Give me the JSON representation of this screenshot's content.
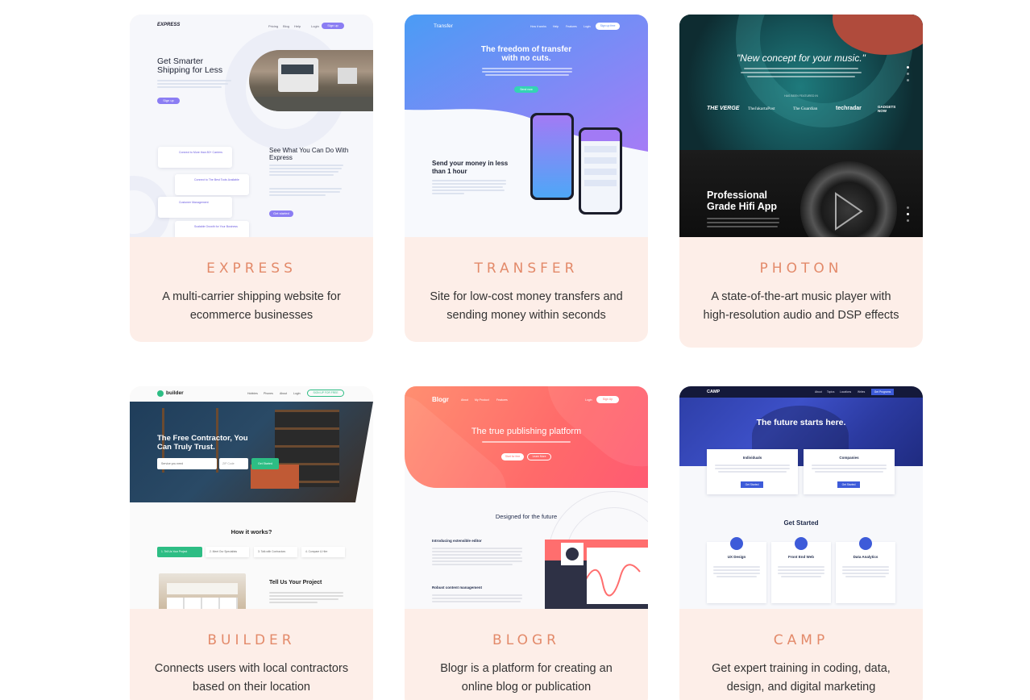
{
  "cards": [
    {
      "title": "EXPRESS",
      "description": "A multi-carrier shipping website for ecommerce businesses",
      "preview": {
        "logo": "EXPRESS",
        "nav": [
          "Pricing",
          "Blog",
          "Help",
          "Login",
          "Sign up"
        ],
        "hero_heading": "Get Smarter Shipping for Less",
        "hero_button": "Sign up",
        "section_heading": "See What You Can Do With Express",
        "section_button": "Get started",
        "features": [
          "Connect to More than 80+ Carriers",
          "Connect to The Best Tools Available",
          "Customer Management",
          "Scalable Growth for Your Business"
        ]
      }
    },
    {
      "title": "TRANSFER",
      "description": "Site for low-cost money transfers and sending money within seconds",
      "preview": {
        "logo": "Transfer",
        "nav": [
          "How it works",
          "Help",
          "Features",
          "Login",
          "Sign up free"
        ],
        "hero_heading": "The freedom of transfer with no cuts.",
        "hero_button": "Send now",
        "section_heading": "Send your money in less than 1 hour"
      }
    },
    {
      "title": "PHOTON",
      "description": "A state-of-the-art music player with high-resolution audio and DSP effects",
      "preview": {
        "hero_quote": "\"New concept for your music.\"",
        "featured_label": "HAS BEEN FEATURED IN",
        "press": [
          "THE VERGE",
          "TheJakartaPost",
          "The Guardian",
          "techradar",
          "GADGETS NOW"
        ],
        "section_heading": "Professional Grade Hifi App"
      }
    },
    {
      "title": "BUILDER",
      "description": "Connects users with local contractors based on their location",
      "preview": {
        "logo": "builder",
        "nav": [
          "Hobbies",
          "Phones",
          "About",
          "Login",
          "SIGN UP FOR FREE"
        ],
        "hero_heading": "The Free Contractor, You Can Truly Trust.",
        "select_placeholder": "Service you need",
        "zip_placeholder": "ZIP Code",
        "hero_button": "Get Started",
        "how_heading": "How it works?",
        "steps": [
          "1. Tell Us Your Project",
          "2. Meet Our Specialists",
          "3. Talk with Contractors",
          "4. Compare & Hire"
        ],
        "project_heading": "Tell Us Your Project"
      }
    },
    {
      "title": "BLOGR",
      "description": "Blogr is a platform for creating an online blog or publication",
      "preview": {
        "logo": "Blogr",
        "nav": [
          "About",
          "My Product",
          "Features",
          "Login",
          "Sign Up"
        ],
        "hero_heading": "The true publishing platform",
        "hero_buttons": [
          "Start for free",
          "Learn More"
        ],
        "section_heading": "Designed for the future",
        "feature_1": "Introducing extensible editor",
        "feature_2": "Robust content management"
      }
    },
    {
      "title": "CAMP",
      "description": "Get expert training in coding, data, design, and digital marketing",
      "preview": {
        "logo": "CAMP",
        "nav": [
          "About",
          "Topics",
          "Locations",
          "Writes",
          "Get Programs"
        ],
        "hero_heading": "The future starts here.",
        "audiences": [
          "Individuals",
          "Companies"
        ],
        "audience_button": "Get Started",
        "get_started": "Get Started",
        "courses": [
          "UX Design",
          "Front End Web",
          "Data Analytics"
        ]
      }
    }
  ],
  "colors": {
    "card_bg": "#fdeee8",
    "title": "#e38a6a"
  }
}
